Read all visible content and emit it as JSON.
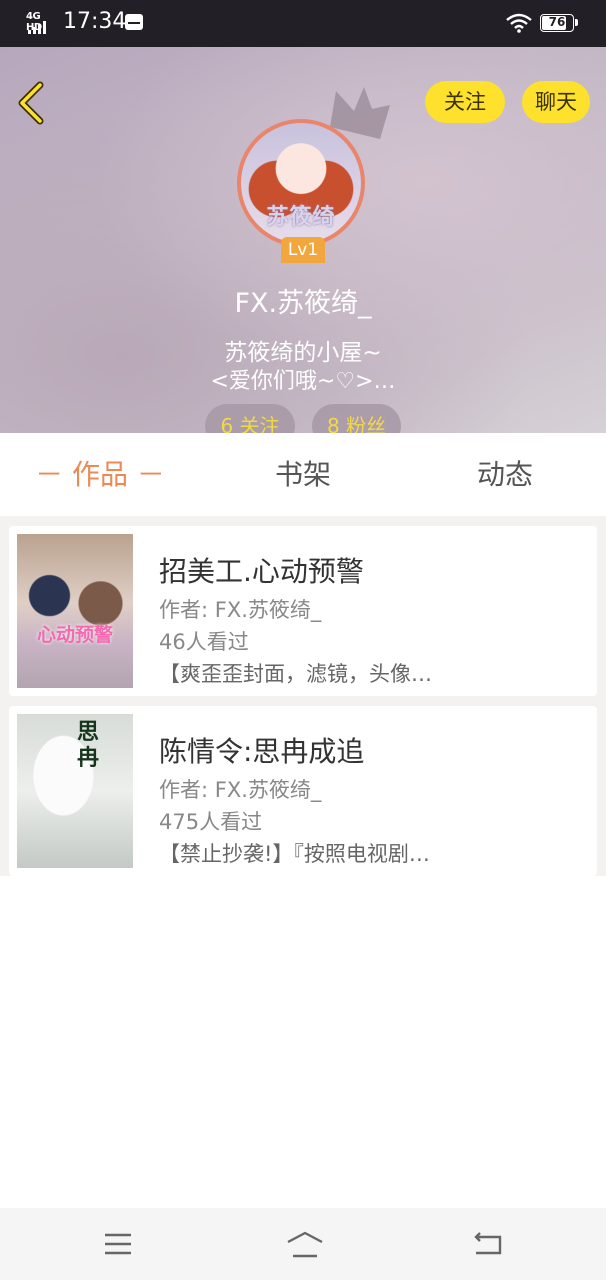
{
  "status_bar": {
    "network": "4G HD",
    "time": "17:34",
    "battery": "76"
  },
  "header": {
    "follow_label": "关注",
    "chat_label": "聊天",
    "avatar_text": "苏筱绮",
    "level": "Lv1",
    "username": "FX.苏筱绮_",
    "bio_line1": "苏筱绮的小屋~",
    "bio_line2": "<爱你们哦~♡>…",
    "following": "6 关注",
    "followers": "8 粉丝"
  },
  "tabs": [
    {
      "label": "－ 作品 －"
    },
    {
      "label": "书架"
    },
    {
      "label": "动态"
    }
  ],
  "works": [
    {
      "title": "招美工.心动预警",
      "author": "作者: FX.苏筱绮_",
      "views": "46人看过",
      "desc": "【爽歪歪封面，滤镜，头像…",
      "cover_text": "心动预警"
    },
    {
      "title": "陈情令:思冉成追",
      "author": "作者: FX.苏筱绮_",
      "views": "475人看过",
      "desc": "【禁止抄袭!】『按照电视剧…",
      "cover_text": "思冉"
    }
  ],
  "icons": [
    "back-chevron-icon",
    "crown-icon",
    "menu-icon",
    "home-icon",
    "back-icon",
    "wifi-icon",
    "battery-icon",
    "signal-icon",
    "notification-icon"
  ],
  "colors": {
    "accent": "#ec8a56",
    "button_yellow": "#fde12c",
    "level_badge": "#f1a73d",
    "pill_text": "#f7dd3b"
  }
}
